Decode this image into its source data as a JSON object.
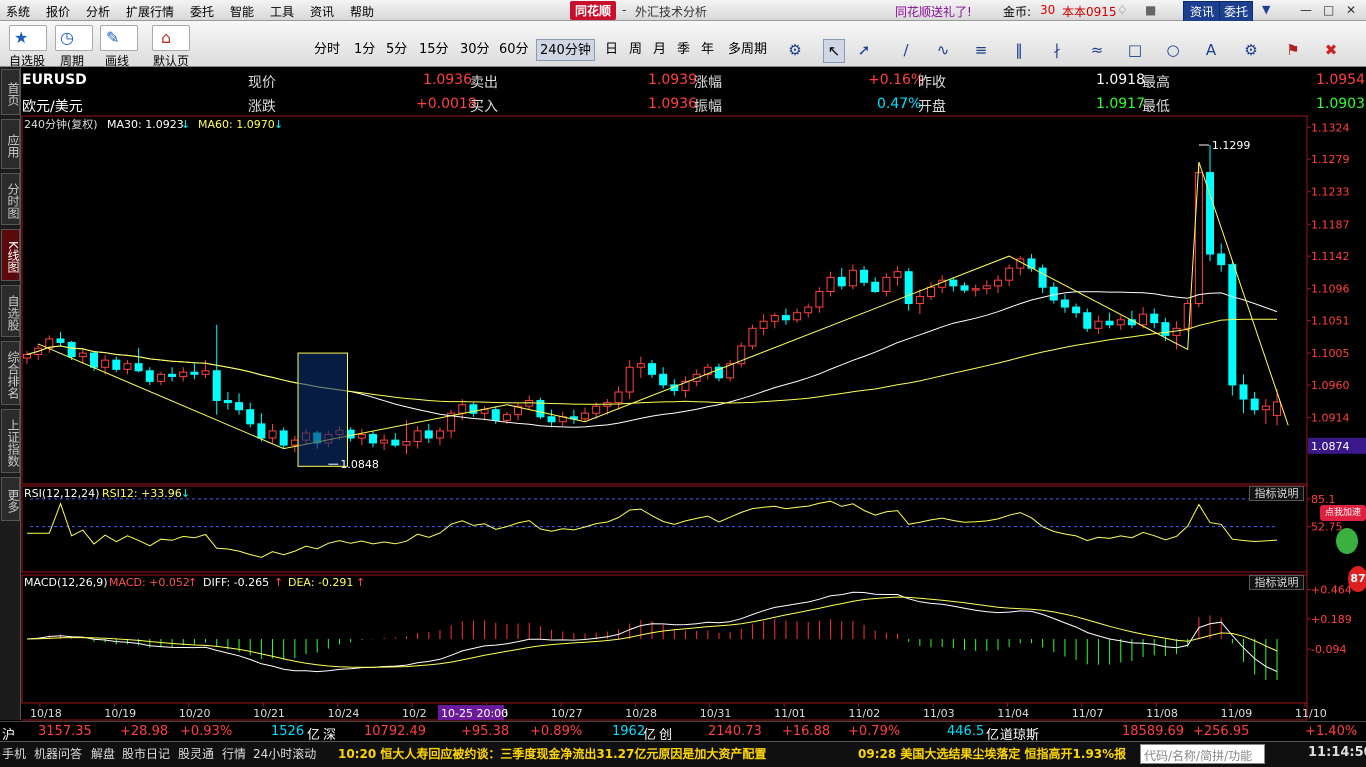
{
  "menu": {
    "items": [
      "系统",
      "报价",
      "分析",
      "扩展行情",
      "委托",
      "智能",
      "工具",
      "资讯",
      "帮助"
    ],
    "app_title": "同花顺",
    "window_title": "外汇技术分析",
    "promo": "同花顺送礼了!",
    "coins_label": "金币:",
    "coins_value": "30",
    "version": "本本0915",
    "news_btn": "资讯",
    "trade_btn": "委托"
  },
  "toolbar": {
    "labels": [
      "自选股",
      "周期",
      "画线",
      "默认页"
    ],
    "periods": [
      "分时",
      "1分",
      "5分",
      "15分",
      "30分",
      "60分",
      "240分钟",
      "日",
      "周",
      "月",
      "季",
      "年",
      "多周期"
    ],
    "selected_period": "240分钟"
  },
  "sidebar": {
    "tabs": [
      "首页",
      "应用",
      "分时图",
      "K线图",
      "自选股",
      "综合排名",
      "上证指数",
      "更多"
    ],
    "selected": "K线图"
  },
  "quote": {
    "symbol": "EURUSD",
    "name": "欧元/美元",
    "l_xj": "现价",
    "xj": "1.0936",
    "l_mc": "卖出",
    "mc": "1.0939",
    "l_zf": "涨幅",
    "zf": "+0.16%",
    "l_zs": "昨收",
    "zs": "1.0918",
    "l_zg": "最高",
    "zg": "1.0954",
    "l_zd": "涨跌",
    "zd": "+0.0018",
    "l_mr": "买入",
    "mr": "1.0936",
    "l_zhenfu": "振幅",
    "zhenfu": "0.47%",
    "l_kp": "开盘",
    "kp": "1.0917",
    "l_zdi": "最低",
    "zdi": "1.0903"
  },
  "ma_legend": {
    "period": "240分钟(复权)",
    "ma30": "MA30: 1.0923",
    "ma60": "MA60: 1.0970"
  },
  "chart_data": [
    {
      "type": "candlestick",
      "title": "240分钟(复权)",
      "y_ticks": [
        "1.1324",
        "1.1279",
        "1.1233",
        "1.1187",
        "1.1142",
        "1.1096",
        "1.1051",
        "1.1005",
        "1.0960",
        "1.0914",
        "1.0874"
      ],
      "ylim": [
        1.082,
        1.134
      ],
      "x_ticks": [
        "10/18",
        "10/19",
        "10/20",
        "10/21",
        "10/24",
        "10/2",
        "10/26",
        "10/27",
        "10/28",
        "10/31",
        "11/01",
        "11/02",
        "11/03",
        "11/04",
        "11/07",
        "11/08",
        "11/09",
        "11/10"
      ],
      "cursor_label": "10-25 20:00",
      "annotations": [
        "1.1299",
        "1.0848"
      ],
      "ohlc": [
        [
          1.0998,
          1.1008,
          1.099,
          1.1003
        ],
        [
          1.1003,
          1.1018,
          1.0995,
          1.1012
        ],
        [
          1.1012,
          1.103,
          1.1005,
          1.1025
        ],
        [
          1.1025,
          1.1035,
          1.1015,
          1.102
        ],
        [
          1.102,
          1.1022,
          1.0995,
          1.1
        ],
        [
          1.1,
          1.1012,
          1.099,
          1.1005
        ],
        [
          1.1005,
          1.1008,
          1.098,
          1.0985
        ],
        [
          1.0985,
          1.1002,
          1.0975,
          1.0995
        ],
        [
          1.0995,
          1.1,
          1.0978,
          1.0982
        ],
        [
          1.0982,
          1.0995,
          1.0975,
          1.099
        ],
        [
          1.099,
          1.1012,
          1.0978,
          1.098
        ],
        [
          1.098,
          1.0985,
          1.096,
          1.0965
        ],
        [
          1.0965,
          1.0978,
          1.096,
          1.0975
        ],
        [
          1.0975,
          1.0985,
          1.0965,
          1.0972
        ],
        [
          1.0972,
          1.0985,
          1.0965,
          1.0978
        ],
        [
          1.0978,
          1.099,
          1.0968,
          1.0975
        ],
        [
          1.0975,
          1.0995,
          1.097,
          1.098
        ],
        [
          1.098,
          1.1045,
          1.0918,
          1.0938
        ],
        [
          1.0938,
          1.095,
          1.0925,
          1.0935
        ],
        [
          1.0935,
          1.0948,
          1.0918,
          1.0925
        ],
        [
          1.0925,
          1.0935,
          1.09,
          1.0905
        ],
        [
          1.0905,
          1.092,
          1.088,
          1.0885
        ],
        [
          1.0885,
          1.0905,
          1.0878,
          1.0895
        ],
        [
          1.0895,
          1.09,
          1.087,
          1.0875
        ],
        [
          1.0875,
          1.0888,
          1.0865,
          1.0882
        ],
        [
          1.0882,
          1.0898,
          1.0875,
          1.0892
        ],
        [
          1.0892,
          1.0895,
          1.087,
          1.0878
        ],
        [
          1.0878,
          1.0895,
          1.0872,
          1.089
        ],
        [
          1.089,
          1.0902,
          1.0882,
          1.0896
        ],
        [
          1.0896,
          1.09,
          1.088,
          1.0885
        ],
        [
          1.0885,
          1.0898,
          1.0875,
          1.089
        ],
        [
          1.089,
          1.0895,
          1.0872,
          1.0878
        ],
        [
          1.0878,
          1.089,
          1.0868,
          1.0882
        ],
        [
          1.0882,
          1.0892,
          1.0872,
          1.0875
        ],
        [
          1.0875,
          1.091,
          1.0862,
          1.088
        ],
        [
          1.088,
          1.0902,
          1.087,
          1.0895
        ],
        [
          1.0895,
          1.0905,
          1.0878,
          1.0885
        ],
        [
          1.0885,
          1.09,
          1.0875,
          1.0895
        ],
        [
          1.0895,
          1.0925,
          1.0885,
          1.092
        ],
        [
          1.092,
          1.094,
          1.091,
          1.0932
        ],
        [
          1.0932,
          1.0935,
          1.0915,
          1.092
        ],
        [
          1.092,
          1.093,
          1.091,
          1.0925
        ],
        [
          1.0925,
          1.093,
          1.0905,
          1.091
        ],
        [
          1.091,
          1.0922,
          1.0905,
          1.0918
        ],
        [
          1.0918,
          1.0935,
          1.091,
          1.093
        ],
        [
          1.093,
          1.0945,
          1.0925,
          1.0938
        ],
        [
          1.0938,
          1.0942,
          1.0912,
          1.0915
        ],
        [
          1.0915,
          1.0925,
          1.09,
          1.0908
        ],
        [
          1.0908,
          1.0922,
          1.0902,
          1.0915
        ],
        [
          1.0915,
          1.0925,
          1.0905,
          1.0912
        ],
        [
          1.0912,
          1.0928,
          1.0908,
          1.092
        ],
        [
          1.092,
          1.0935,
          1.0912,
          1.093
        ],
        [
          1.093,
          1.094,
          1.0918,
          1.0935
        ],
        [
          1.0935,
          1.0958,
          1.0925,
          1.095
        ],
        [
          1.095,
          1.0995,
          1.094,
          1.0985
        ],
        [
          1.0985,
          1.1,
          1.097,
          1.099
        ],
        [
          1.099,
          1.0995,
          1.097,
          1.0975
        ],
        [
          1.0975,
          1.0985,
          1.0955,
          1.096
        ],
        [
          1.096,
          1.0968,
          1.0945,
          1.0952
        ],
        [
          1.0952,
          1.0972,
          1.0942,
          1.0965
        ],
        [
          1.0965,
          1.0982,
          1.0958,
          1.0975
        ],
        [
          1.0975,
          1.099,
          1.0968,
          1.0985
        ],
        [
          1.0985,
          1.099,
          1.0965,
          1.097
        ],
        [
          1.097,
          1.0995,
          1.0965,
          1.099
        ],
        [
          1.099,
          1.102,
          1.0985,
          1.1015
        ],
        [
          1.1015,
          1.1045,
          1.101,
          1.104
        ],
        [
          1.104,
          1.106,
          1.103,
          1.105
        ],
        [
          1.105,
          1.1062,
          1.104,
          1.1058
        ],
        [
          1.1058,
          1.1068,
          1.1045,
          1.1052
        ],
        [
          1.1052,
          1.1068,
          1.1048,
          1.1062
        ],
        [
          1.1062,
          1.1075,
          1.1055,
          1.107
        ],
        [
          1.107,
          1.1098,
          1.1062,
          1.1092
        ],
        [
          1.1092,
          1.112,
          1.1085,
          1.1112
        ],
        [
          1.1112,
          1.1125,
          1.1095,
          1.11
        ],
        [
          1.11,
          1.113,
          1.1095,
          1.1122
        ],
        [
          1.1122,
          1.1128,
          1.11,
          1.1105
        ],
        [
          1.1105,
          1.1112,
          1.109,
          1.1092
        ],
        [
          1.1092,
          1.1118,
          1.1085,
          1.1112
        ],
        [
          1.1112,
          1.1128,
          1.11,
          1.112
        ],
        [
          1.112,
          1.1125,
          1.1065,
          1.1075
        ],
        [
          1.1075,
          1.1095,
          1.106,
          1.1085
        ],
        [
          1.1085,
          1.1105,
          1.108,
          1.1098
        ],
        [
          1.1098,
          1.1115,
          1.109,
          1.1108
        ],
        [
          1.1108,
          1.1112,
          1.1092,
          1.11
        ],
        [
          1.11,
          1.1105,
          1.109,
          1.1094
        ],
        [
          1.1094,
          1.1102,
          1.1085,
          1.1096
        ],
        [
          1.1096,
          1.1108,
          1.1088,
          1.11
        ],
        [
          1.11,
          1.1115,
          1.109,
          1.1108
        ],
        [
          1.1108,
          1.113,
          1.11,
          1.1125
        ],
        [
          1.1125,
          1.1142,
          1.1115,
          1.1138
        ],
        [
          1.1138,
          1.1145,
          1.112,
          1.1125
        ],
        [
          1.1125,
          1.113,
          1.109,
          1.1098
        ],
        [
          1.1098,
          1.1105,
          1.1075,
          1.108
        ],
        [
          1.108,
          1.1088,
          1.1062,
          1.107
        ],
        [
          1.107,
          1.1075,
          1.1055,
          1.1062
        ],
        [
          1.1062,
          1.1068,
          1.1035,
          1.104
        ],
        [
          1.104,
          1.1058,
          1.1032,
          1.105
        ],
        [
          1.105,
          1.1062,
          1.104,
          1.1045
        ],
        [
          1.1045,
          1.1058,
          1.1038,
          1.1052
        ],
        [
          1.1052,
          1.1065,
          1.104,
          1.1045
        ],
        [
          1.1045,
          1.107,
          1.104,
          1.106
        ],
        [
          1.106,
          1.1068,
          1.104,
          1.1048
        ],
        [
          1.1048,
          1.1055,
          1.1022,
          1.103
        ],
        [
          1.103,
          1.105,
          1.101,
          1.104
        ],
        [
          1.104,
          1.108,
          1.1035,
          1.1075
        ],
        [
          1.1075,
          1.1275,
          1.107,
          1.126
        ],
        [
          1.126,
          1.1299,
          1.1135,
          1.1145
        ],
        [
          1.1145,
          1.116,
          1.112,
          1.113
        ],
        [
          1.113,
          1.1135,
          1.0945,
          1.096
        ],
        [
          1.096,
          1.0975,
          1.092,
          1.094
        ],
        [
          1.094,
          1.095,
          1.0918,
          1.0925
        ],
        [
          1.0925,
          1.094,
          1.0905,
          1.093
        ],
        [
          1.0917,
          1.0954,
          1.0903,
          1.0936
        ]
      ],
      "ma_series": [
        {
          "name": "MA30",
          "color": "#ffffff"
        },
        {
          "name": "MA60",
          "color": "#ffff55"
        }
      ],
      "colors": {
        "up": "#ff4040",
        "down": "#00ffff",
        "zigzag": "#ffff55"
      }
    },
    {
      "type": "line",
      "title": "RSI(12,12,24)",
      "legend": "RSI12: +33.96",
      "y_ticks": [
        "85.1",
        "52.75"
      ],
      "ylim": [
        0,
        100
      ],
      "btn": "指标说明",
      "color": "#ffff55"
    },
    {
      "type": "bar+line",
      "title": "MACD(12,26,9)",
      "macd_label": "MACD: +0.052",
      "diff_label": "DIFF: -0.265",
      "dea_label": "DEA: -0.291",
      "y_ticks": [
        "+0.464",
        "+0.189",
        "-0.094"
      ],
      "btn": "指标说明"
    }
  ],
  "ticker": {
    "sh_label": "沪",
    "sh_value": "3157.35",
    "sh_chg": "+28.98",
    "sh_pct": "+0.93%",
    "sh_amt": "1526",
    "yi": "亿",
    "sz_label": "深",
    "sz_value": "10792.49",
    "sz_chg": "+95.38",
    "sz_pct": "+0.89%",
    "sz_amt": "1962",
    "cy_label": "创",
    "cy_value": "2140.73",
    "cy_chg": "+16.88",
    "cy_pct": "+0.79%",
    "cy_amt": "446.5",
    "dj_label": "道琼斯",
    "dj_value": "18589.69",
    "dj_chg": "+256.95",
    "dj_pct": "+1.40%"
  },
  "statusbar": {
    "items": [
      "手机",
      "机器问答",
      "解盘",
      "股市日记",
      "股灵通",
      "行情",
      "24小时滚动"
    ],
    "news1": "10:20 恒大人寿回应被约谈：三季度现金净流出31.27亿元原因是加大资产配置",
    "news2": "09:28 美国大选结果尘埃落定 恒指高开1.93%报",
    "search": "代码/名称/简拼/功能",
    "time": "11:14:50"
  },
  "float_badge": {
    "label": "点我加速",
    "value": "87"
  }
}
